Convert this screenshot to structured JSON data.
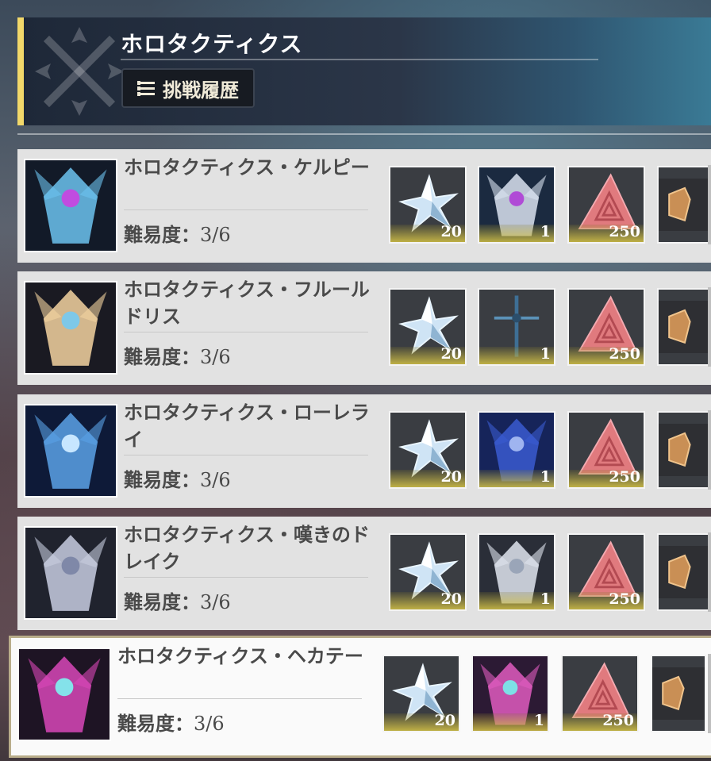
{
  "header": {
    "title": "ホロタクティクス",
    "history_button": "挑戦履歴"
  },
  "difficulty_label": "難易度：",
  "colors": {
    "accent_bar": "#f2d86a",
    "card_bg": "#e2e2e2",
    "selected_border": "#b9ad8a"
  },
  "challenges": [
    {
      "title": "ホロタクティクス・ケルピー",
      "difficulty": "3/6",
      "portrait_icon": "kelpie-portrait",
      "rewards": [
        {
          "icon": "star-crystal-icon",
          "count": "20"
        },
        {
          "icon": "kelpie-icon",
          "count": "1"
        },
        {
          "icon": "red-triangle-icon",
          "count": "250"
        },
        {
          "icon": "gold-gem-icon",
          "count": ""
        }
      ]
    },
    {
      "title": "ホロタクティクス・フルールドリス",
      "difficulty": "3/6",
      "portrait_icon": "fleur-de-lis-portrait",
      "rewards": [
        {
          "icon": "star-crystal-icon",
          "count": "20"
        },
        {
          "icon": "sword-icon",
          "count": "1"
        },
        {
          "icon": "red-triangle-icon",
          "count": "250"
        },
        {
          "icon": "gold-gem-icon",
          "count": ""
        }
      ]
    },
    {
      "title": "ホロタクティクス・ローレライ",
      "difficulty": "3/6",
      "portrait_icon": "lorelei-portrait",
      "rewards": [
        {
          "icon": "star-crystal-icon",
          "count": "20"
        },
        {
          "icon": "lorelei-icon",
          "count": "1"
        },
        {
          "icon": "red-triangle-icon",
          "count": "250"
        },
        {
          "icon": "gold-gem-icon",
          "count": ""
        }
      ]
    },
    {
      "title": "ホロタクティクス・嘆きのドレイク",
      "difficulty": "3/6",
      "portrait_icon": "drake-portrait",
      "rewards": [
        {
          "icon": "star-crystal-icon",
          "count": "20"
        },
        {
          "icon": "drake-icon",
          "count": "1"
        },
        {
          "icon": "red-triangle-icon",
          "count": "250"
        },
        {
          "icon": "gold-gem-icon",
          "count": ""
        }
      ]
    },
    {
      "title": "ホロタクティクス・ヘカテー",
      "difficulty": "3/6",
      "portrait_icon": "hecate-portrait",
      "rewards": [
        {
          "icon": "star-crystal-icon",
          "count": "20"
        },
        {
          "icon": "hecate-icon",
          "count": "1"
        },
        {
          "icon": "red-triangle-icon",
          "count": "250"
        },
        {
          "icon": "gold-gem-icon",
          "count": ""
        }
      ]
    }
  ]
}
